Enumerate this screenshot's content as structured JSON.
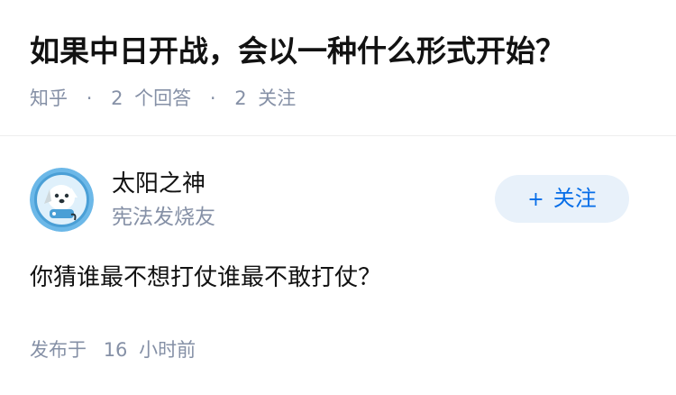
{
  "question": {
    "title": "如果中日开战，会以一种什么形式开始？",
    "site": "知乎",
    "answer_count": "2",
    "answer_label": "个回答",
    "follower_count": "2",
    "follower_label": "关注",
    "separator": "·"
  },
  "answer": {
    "author": {
      "name": "太阳之神",
      "badge": "宪法发烧友",
      "avatar_icon": "cartoon-dog-avatar-icon"
    },
    "follow_button": {
      "plus": "+",
      "label": "关注"
    },
    "content": "你猜谁最不想打仗谁最不敢打仗？",
    "publish_prefix": "发布于",
    "publish_number": "16",
    "publish_unit": "小时前"
  },
  "colors": {
    "title": "#121212",
    "meta": "#8590a6",
    "follow_bg": "#e8f1fa",
    "follow_text": "#056de8",
    "avatar_bg": "#6cb8e8"
  }
}
